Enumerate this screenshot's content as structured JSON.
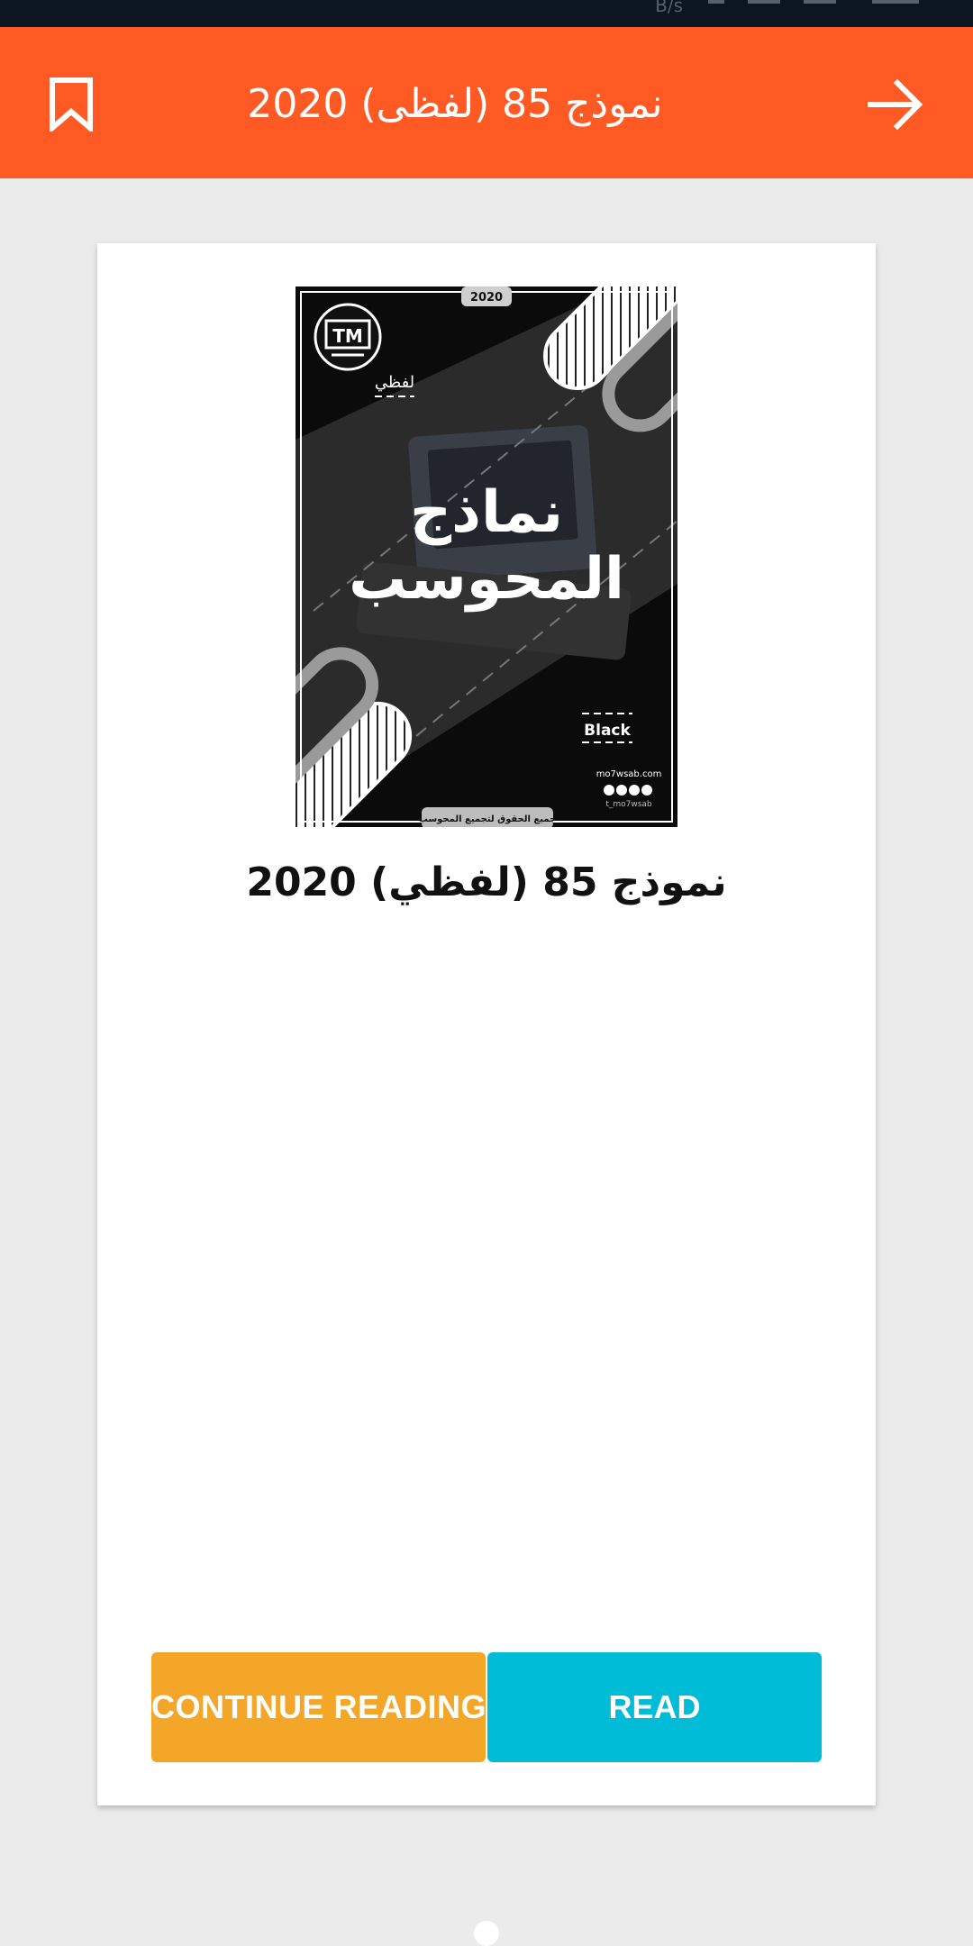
{
  "status_bar": {
    "speed": "B/s"
  },
  "app_bar": {
    "title": "نموذج 85 (لفظى) 2020",
    "bookmark_icon": "bookmark-outline-icon",
    "back_icon": "arrow-forward-icon",
    "background_color": "#ff5a24"
  },
  "book": {
    "title": "نموذج 85 (لفظي) 2020",
    "cover": {
      "year": "2020",
      "logo": "TM",
      "subtitle": "لفظي",
      "heading_line1": "نماذج",
      "heading_line2": "المحوسب",
      "edition": "Black",
      "website": "mo7wsab.com",
      "handle": "t_mo7wsab",
      "footer": "جميع الحقوق لتجميع المحوسب"
    }
  },
  "actions": {
    "continue_label": "CONTINUE READING",
    "read_label": "READ",
    "continue_color": "#f3a628",
    "read_color": "#00bcd6"
  },
  "pager": {
    "page": 1,
    "total": 1
  }
}
